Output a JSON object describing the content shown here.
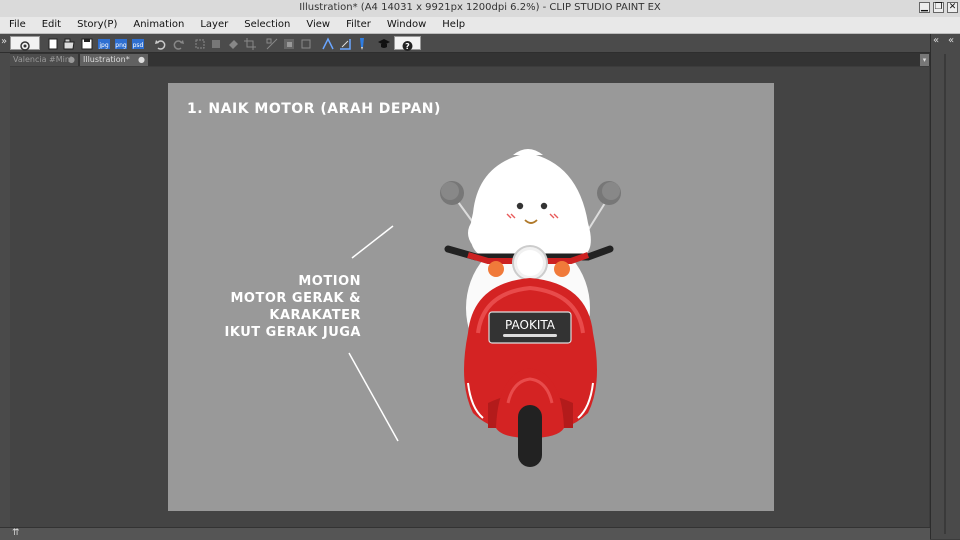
{
  "window": {
    "title": "Illustration* (A4 14031 x 9921px 1200dpi 6.2%)  - CLIP STUDIO PAINT EX",
    "controls": {
      "minimize": "▁",
      "restore": "❐",
      "close": "✕"
    }
  },
  "menu": [
    "File",
    "Edit",
    "Story(P)",
    "Animation",
    "Layer",
    "Selection",
    "View",
    "Filter",
    "Window",
    "Help"
  ],
  "toolbar": {
    "icons": [
      "clip-studio-logo-icon",
      "new-file-icon",
      "open-file-icon",
      "save-icon",
      "export-jpg-icon",
      "export-png-icon",
      "export-psd-icon",
      "undo-icon",
      "redo-icon",
      "transform-icon",
      "clear-icon",
      "fill-icon",
      "crop-icon",
      "selection-icon",
      "quick-mask-icon",
      "snap-ruler-icon",
      "snap-grid-icon",
      "pen-pressure-icon",
      "learn-icon",
      "help-icon"
    ],
    "labels": {
      "jpg": "jpg",
      "png": "png",
      "psd": "psd"
    }
  },
  "tabs": [
    {
      "label": "Valencia #Mini",
      "active": false
    },
    {
      "label": "Illustration*",
      "active": true
    }
  ],
  "canvas": {
    "headline": "1. NAIK MOTOR (ARAH DEPAN)",
    "annotation": [
      "MOTION",
      "MOTOR GERAK &",
      "KARAKATER",
      "IKUT GERAK JUGA"
    ],
    "plate": "PAOKITA"
  },
  "colors": {
    "scooter_red": "#d42323",
    "paper": "#999999",
    "workspace": "#444444"
  }
}
